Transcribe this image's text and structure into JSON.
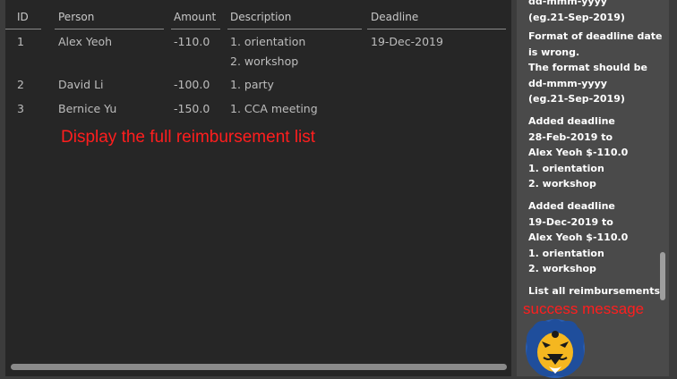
{
  "table": {
    "headers": {
      "id": "ID",
      "person": "Person",
      "amount": "Amount",
      "description": "Description",
      "deadline": "Deadline"
    },
    "rows": [
      {
        "id": "1",
        "person": "Alex Yeoh",
        "amount": "-110.0",
        "description": [
          "1. orientation",
          "2. workshop"
        ],
        "deadline": "19-Dec-2019"
      },
      {
        "id": "2",
        "person": "David Li",
        "amount": "-100.0",
        "description": [
          "1. party"
        ],
        "deadline": ""
      },
      {
        "id": "3",
        "person": "Bernice Yu",
        "amount": "-150.0",
        "description": [
          "1. CCA meeting"
        ],
        "deadline": ""
      }
    ]
  },
  "annotations": {
    "list_caption": "Display the full reimbursement list",
    "result_caption": "success message"
  },
  "log": {
    "entries": [
      "dd-mmm-yyyy\n(eg.21-Sep-2019)",
      "Format of deadline date\nis wrong.\nThe format should be\ndd-mmm-yyyy\n(eg.21-Sep-2019)",
      "Added deadline\n28-Feb-2019 to\nAlex Yeoh $-110.0\n1. orientation\n2. workshop",
      "Added deadline\n19-Dec-2019 to\nAlex Yeoh $-110.0\n1. orientation\n2. workshop",
      "List all reimbursements."
    ]
  },
  "colors": {
    "table_bg": "#262626",
    "log_bg": "#4a4a4a",
    "annotation_red": "#ff1e1e",
    "text_gray": "#bdbdbd"
  },
  "icons": {
    "mascot": "lion-mascot-icon"
  }
}
